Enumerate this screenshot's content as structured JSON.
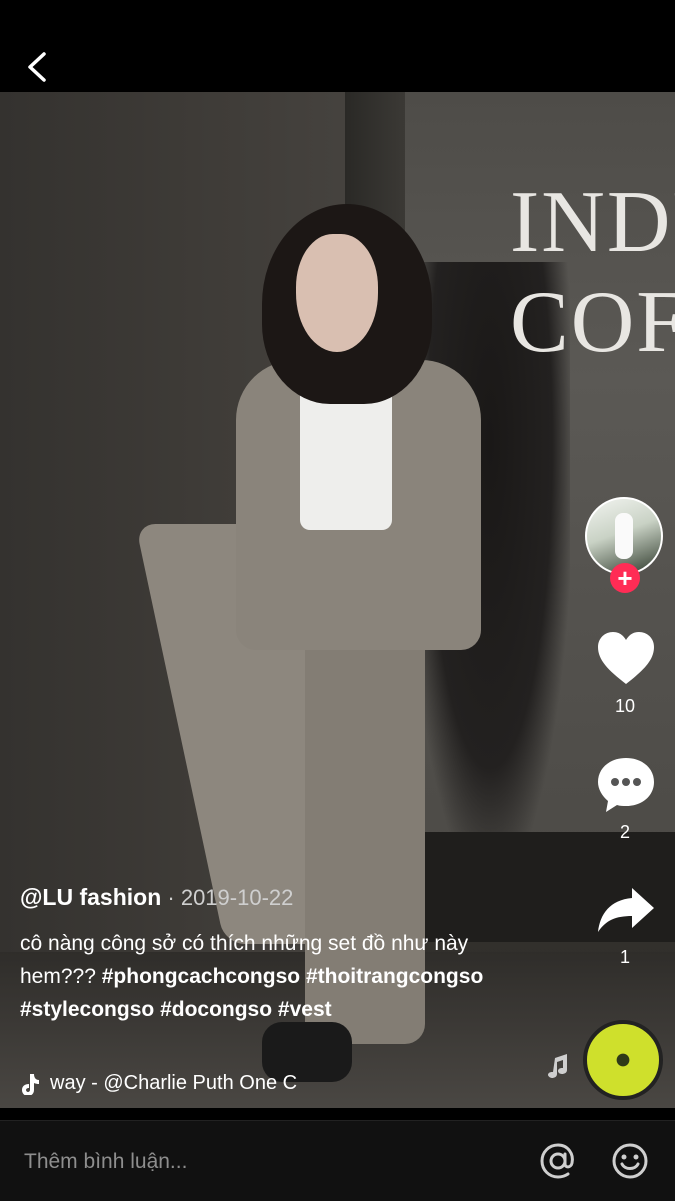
{
  "header": {
    "back_label": "<"
  },
  "video": {
    "window_text_line1": "INDR",
    "window_text_line2": "COF"
  },
  "rail": {
    "like_count": "10",
    "comment_count": "2",
    "share_count": "1"
  },
  "post": {
    "author": "@LU fashion",
    "separator": " · ",
    "date": "2019-10-22",
    "caption_text": "cô nàng công sở có thích những set đồ như này hem??? ",
    "hashtags": [
      "#phongcachcongso",
      "#thoitrangcongso",
      "#stylecongso",
      "#docongso",
      "#vest"
    ],
    "music": "way - @Charlie Puth     One C"
  },
  "comment_bar": {
    "placeholder": "Thêm bình luận..."
  },
  "colors": {
    "follow_accent": "#ff2c55",
    "background": "#000000"
  },
  "icons": [
    "back-icon",
    "heart-icon",
    "comment-icon",
    "share-icon",
    "music-note-icon",
    "at-icon",
    "emoji-icon",
    "plus-icon"
  ]
}
